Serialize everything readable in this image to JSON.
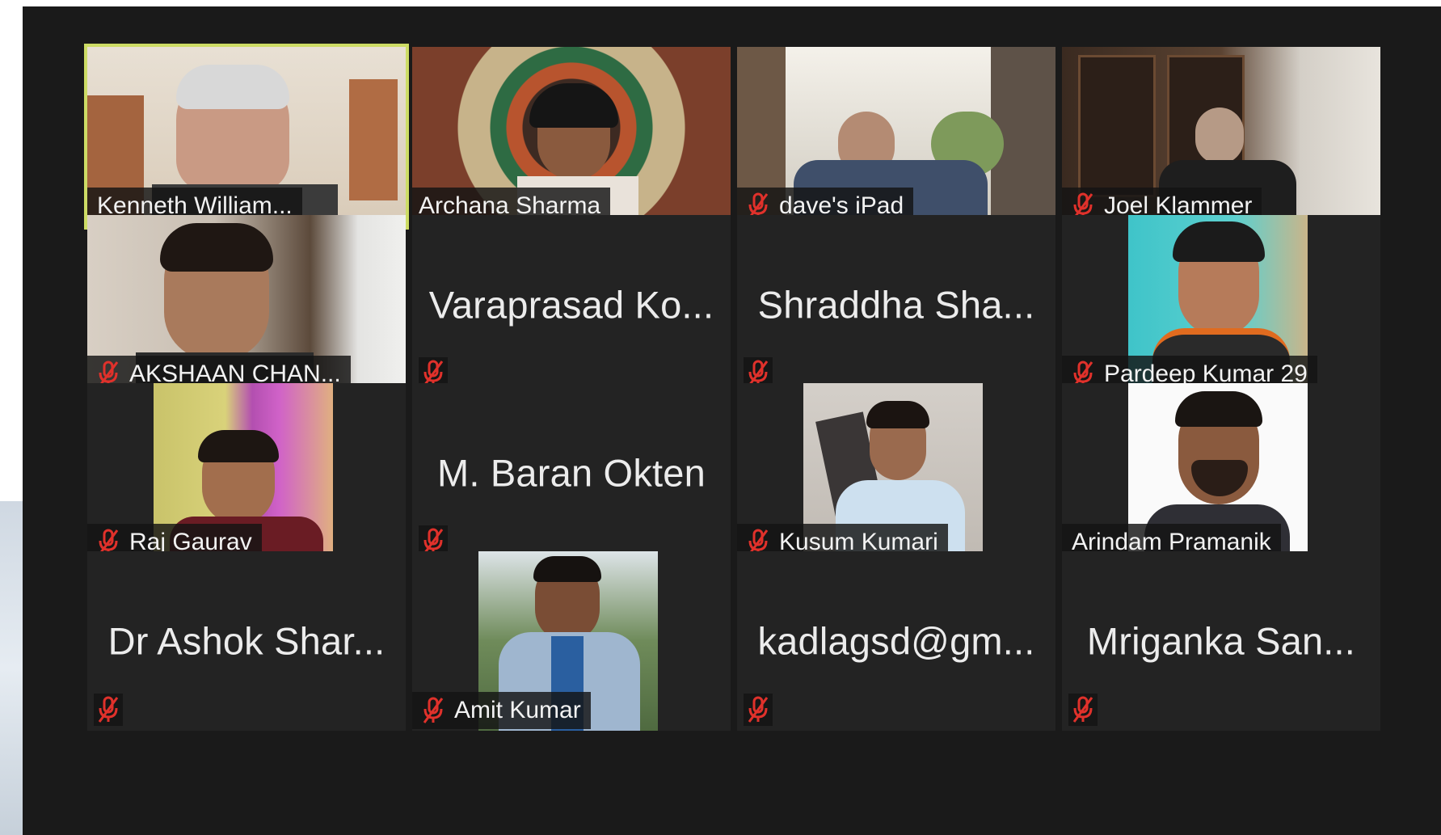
{
  "colors": {
    "window_bg": "#1a1a1a",
    "tile_bg": "#232323",
    "active_speaker_border": "#cddc65",
    "muted_icon": "#e0312b"
  },
  "participants": [
    {
      "name": "Kenneth William...",
      "muted": false,
      "video": true,
      "active_speaker": true
    },
    {
      "name": "Archana Sharma",
      "muted": false,
      "video": true
    },
    {
      "name": "dave's iPad",
      "muted": true,
      "video": true
    },
    {
      "name": "Joel Klammer",
      "muted": true,
      "video": true
    },
    {
      "name": "AKSHAAN CHAN...",
      "muted": true,
      "video": true
    },
    {
      "name": "Varaprasad Ko...",
      "muted": true,
      "video": false
    },
    {
      "name": "Shraddha Sha...",
      "muted": true,
      "video": false
    },
    {
      "name": "Pardeep Kumar 29",
      "muted": true,
      "video": true
    },
    {
      "name": "Raj Gaurav",
      "muted": true,
      "video": true
    },
    {
      "name": "M. Baran Okten",
      "muted": true,
      "video": false
    },
    {
      "name": "Kusum Kumari",
      "muted": true,
      "video": true
    },
    {
      "name": "Arindam Pramanik",
      "muted": false,
      "video": true
    },
    {
      "name": "Dr Ashok Shar...",
      "muted": true,
      "video": false
    },
    {
      "name": "Amit Kumar",
      "muted": true,
      "video": true
    },
    {
      "name": "kadlagsd@gm...",
      "muted": true,
      "video": false
    },
    {
      "name": "Mriganka San...",
      "muted": true,
      "video": false
    }
  ]
}
